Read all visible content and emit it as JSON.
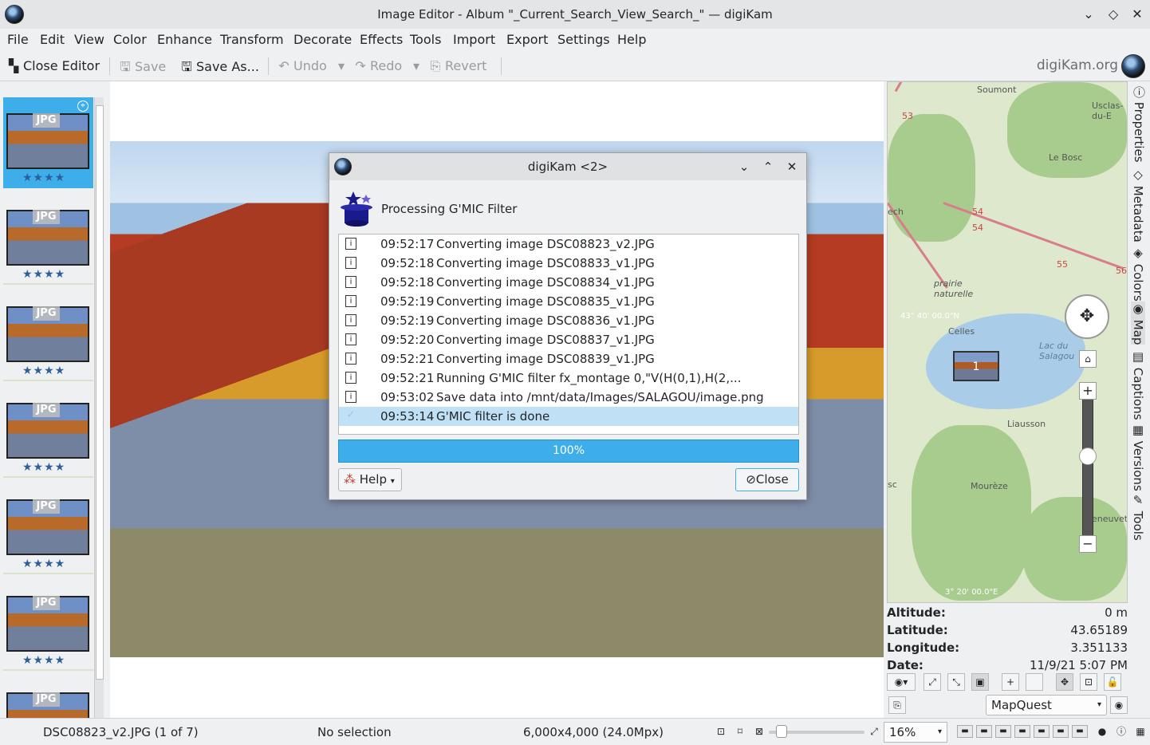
{
  "window": {
    "title": "Image Editor - Album \"_Current_Search_View_Search_\" — digiKam",
    "minimize_icon": "chevron-down-icon",
    "maximize_icon": "diamond-icon",
    "close_icon": "close-icon"
  },
  "menubar": {
    "items": [
      "File",
      "Edit",
      "View",
      "Color",
      "Enhance",
      "Transform",
      "Decorate",
      "Effects",
      "Tools",
      "Import",
      "Export",
      "Settings",
      "Help"
    ]
  },
  "toolbar": {
    "close_editor": "Close Editor",
    "save": "Save",
    "save_as": "Save As...",
    "undo": "Undo",
    "redo": "Redo",
    "revert": "Revert",
    "site": "digiKam.org"
  },
  "thumbnails": {
    "items": [
      {
        "label": "JPG",
        "stars": "★★★★"
      },
      {
        "label": "JPG",
        "stars": "★★★★"
      },
      {
        "label": "JPG",
        "stars": "★★★★"
      },
      {
        "label": "JPG",
        "stars": "★★★★"
      },
      {
        "label": "JPG",
        "stars": "★★★★"
      },
      {
        "label": "JPG",
        "stars": "★★★★"
      },
      {
        "label": "JPG",
        "stars": ""
      }
    ]
  },
  "dialog": {
    "title": "digiKam <2>",
    "heading": "Processing G'MIC Filter",
    "log": [
      {
        "time": "09:52:17",
        "message": "Converting image DSC08823_v2.JPG"
      },
      {
        "time": "09:52:18",
        "message": "Converting image DSC08833_v1.JPG"
      },
      {
        "time": "09:52:18",
        "message": "Converting image DSC08834_v1.JPG"
      },
      {
        "time": "09:52:19",
        "message": "Converting image DSC08835_v1.JPG"
      },
      {
        "time": "09:52:19",
        "message": "Converting image DSC08836_v1.JPG"
      },
      {
        "time": "09:52:20",
        "message": "Converting image DSC08837_v1.JPG"
      },
      {
        "time": "09:52:21",
        "message": "Converting image DSC08839_v1.JPG"
      },
      {
        "time": "09:52:21",
        "message": "Running G'MIC filter fx_montage 0,\"V(H(0,1),H(2,..."
      },
      {
        "time": "09:53:02",
        "message": "Save data into /mnt/data/Images/SALAGOU/image.png"
      },
      {
        "time": "09:53:14",
        "message": "G'MIC filter is done"
      }
    ],
    "progress": "100%",
    "progress_fraction": 1.0,
    "help": "Help",
    "close": "Close"
  },
  "map": {
    "places": [
      "Soumont",
      "Usclas-du-E",
      "Le Bosc",
      "ech",
      "prairie naturelle",
      "Celles",
      "Lac du Salagou",
      "Liausson",
      "Mourèze",
      "sc",
      "eneuvet"
    ],
    "roads": [
      "53",
      "54",
      "54",
      "55",
      "56"
    ],
    "coord_lat": "43° 40' 00.0\"N",
    "coord_lon": "3° 20' 00.0\"E",
    "cluster_count": "1"
  },
  "info": {
    "altitude_label": "Altitude:",
    "altitude": "0 m",
    "latitude_label": "Latitude:",
    "latitude": "43.65189",
    "longitude_label": "Longitude:",
    "longitude": "3.351133",
    "date_label": "Date:",
    "date": "11/9/21 5:07 PM"
  },
  "map_source": "MapQuest",
  "side_tabs": [
    "Properties",
    "Metadata",
    "Colors",
    "Map",
    "Captions",
    "Versions",
    "Tools"
  ],
  "status": {
    "file": "DSC08823_v2.JPG (1 of 7)",
    "selection": "No selection",
    "dimensions": "6,000x4,000 (24.0Mpx)",
    "zoom": "16%"
  }
}
